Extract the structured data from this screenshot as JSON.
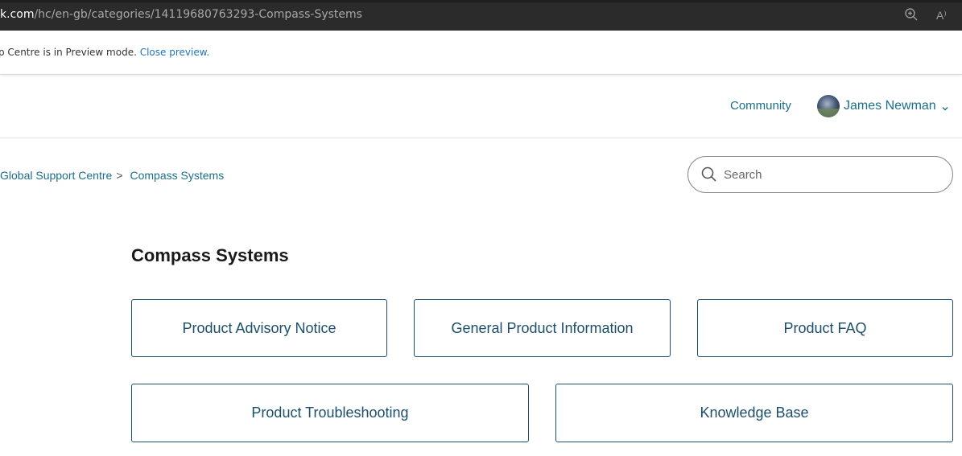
{
  "browser": {
    "url_host": "k.com",
    "url_path": "/hc/en-gb/categories/14119680763293-Compass-Systems",
    "read_aloud_glyph": "A⁾",
    "icons": [
      "zoom-icon",
      "read-aloud-icon"
    ]
  },
  "preview_banner": {
    "text": "p Centre is in Preview mode. ",
    "link": "Close preview."
  },
  "header": {
    "community": "Community",
    "user_name": "James Newman"
  },
  "breadcrumb": {
    "items": [
      "Global Support Centre",
      "Compass Systems"
    ],
    "separator": ">"
  },
  "search": {
    "placeholder": "Search",
    "value": ""
  },
  "page": {
    "title": "Compass Systems"
  },
  "sections": [
    "Product Advisory Notice",
    "General Product Information",
    "Product FAQ",
    "Product Troubleshooting",
    "Knowledge Base"
  ],
  "colors": {
    "link": "#1b6f8a",
    "card_border": "#1b4f6b",
    "banner_link": "#1f73b7"
  }
}
